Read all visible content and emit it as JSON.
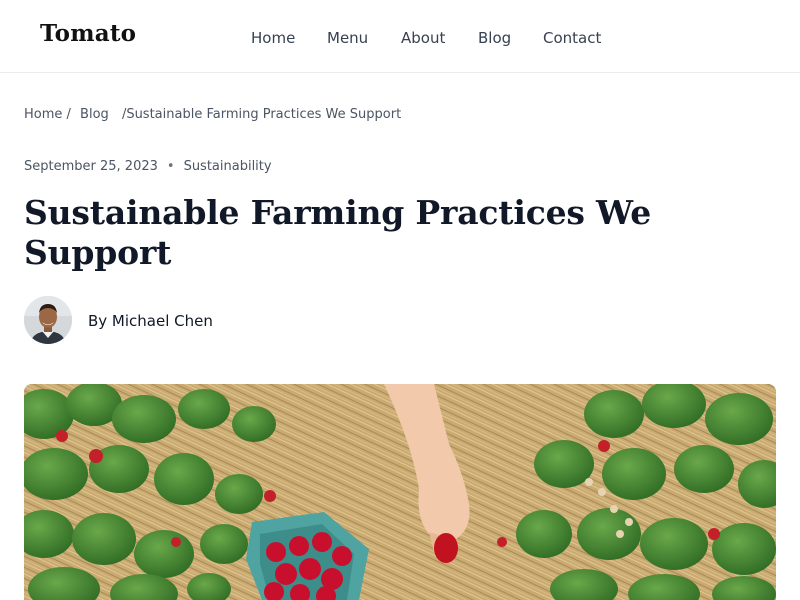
{
  "header": {
    "logo": "Tomato",
    "nav": [
      {
        "label": "Home"
      },
      {
        "label": "Menu"
      },
      {
        "label": "About"
      },
      {
        "label": "Blog"
      },
      {
        "label": "Contact"
      }
    ]
  },
  "breadcrumb": {
    "home": "Home /",
    "blog": "Blog",
    "current": "/Sustainable Farming Practices We Support"
  },
  "article": {
    "date": "September 25, 2023",
    "separator": "•",
    "category": "Sustainability",
    "title": "Sustainable Farming Practices We Support",
    "author": "By Michael Chen"
  }
}
